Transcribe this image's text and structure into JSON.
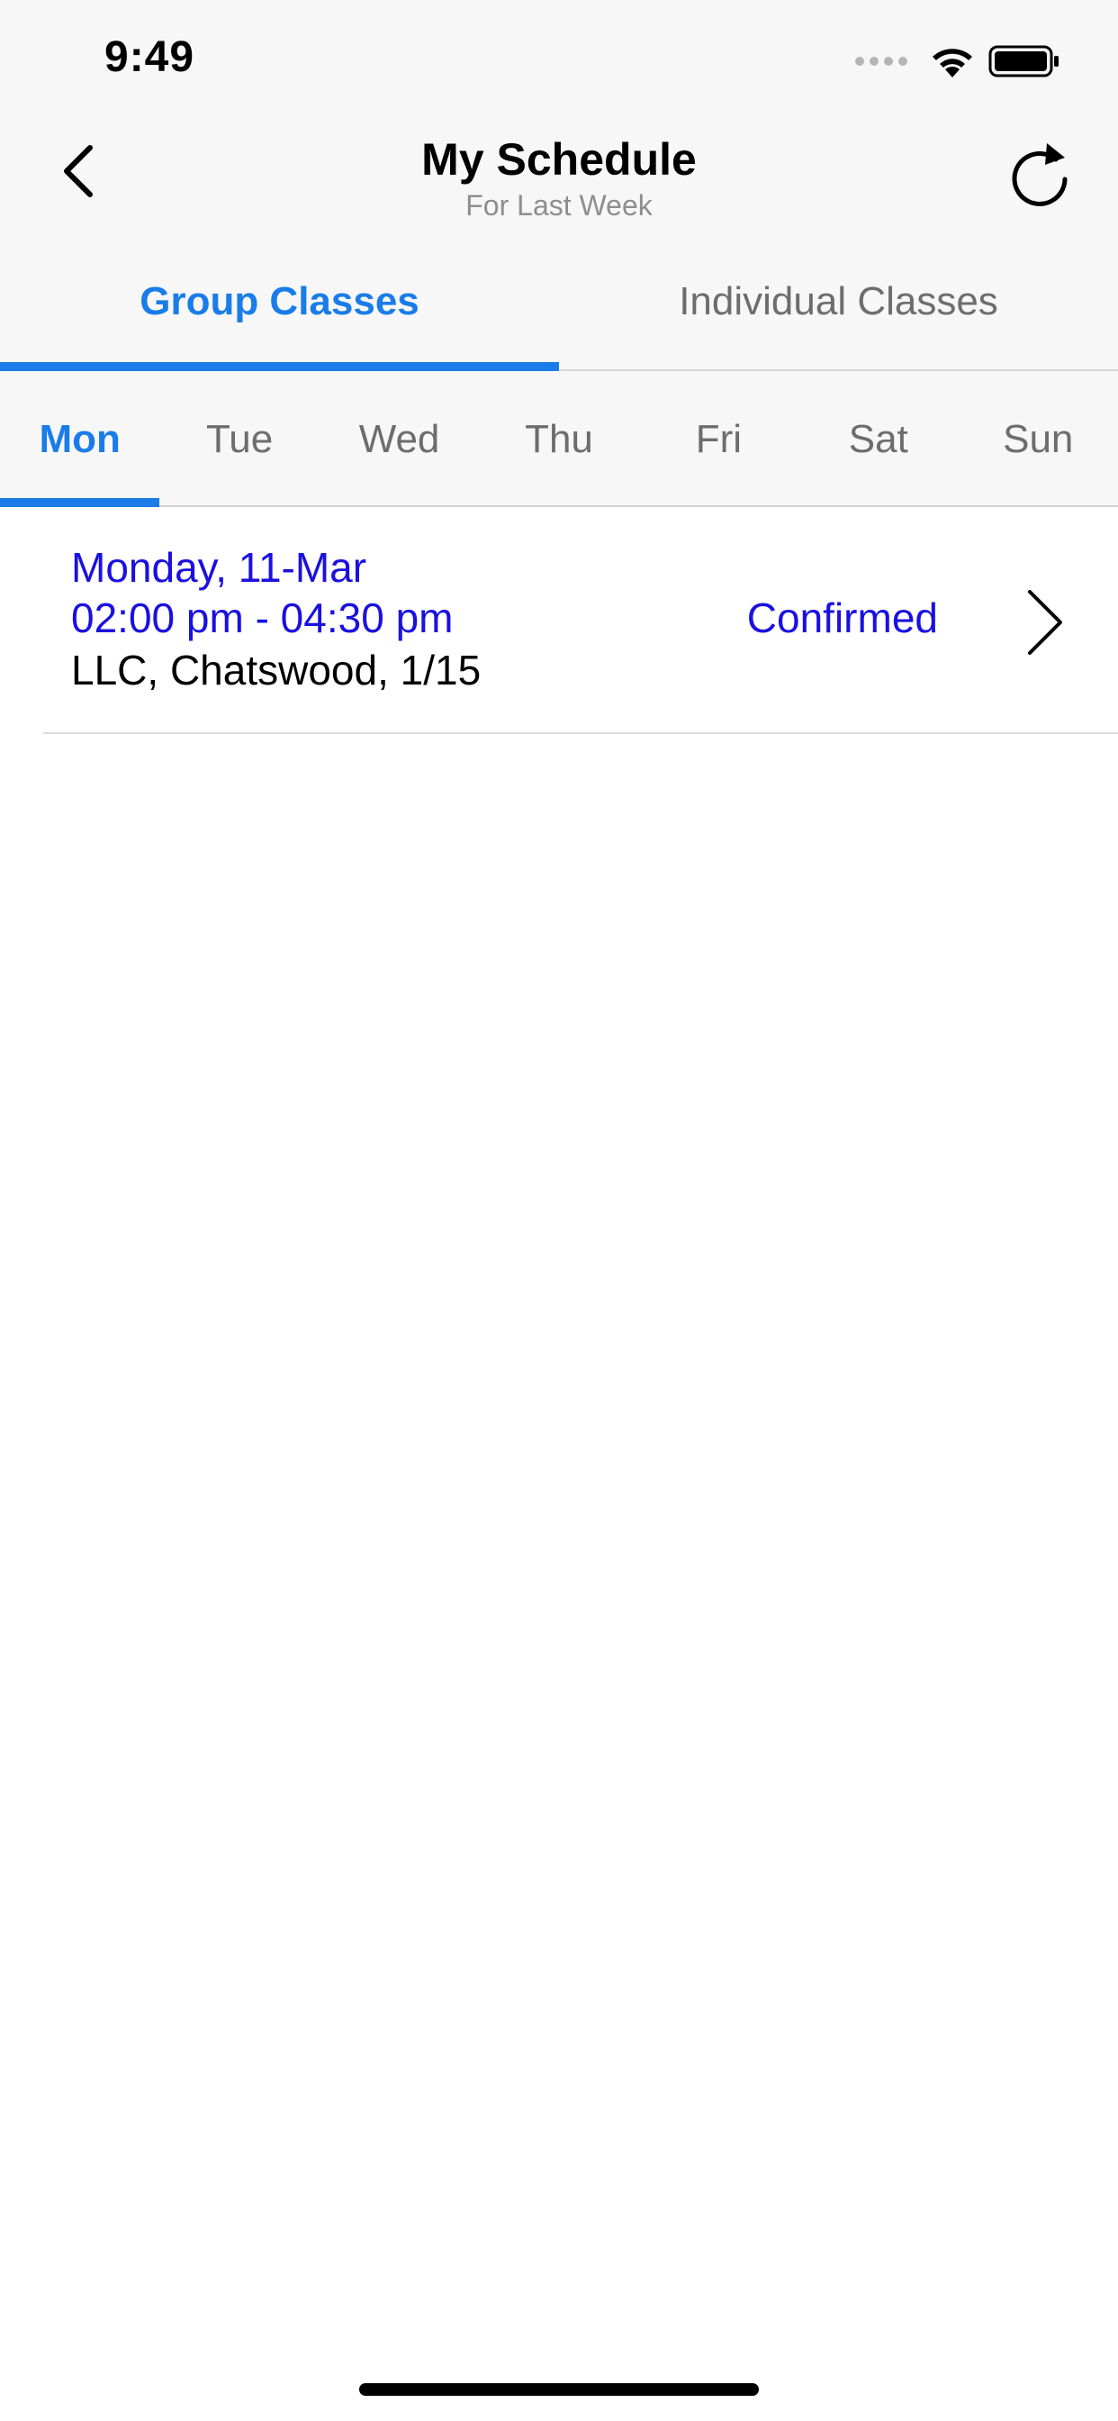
{
  "status_bar": {
    "time": "9:49",
    "icons": [
      "cellular-signal-icon",
      "wifi-icon",
      "battery-icon"
    ]
  },
  "nav": {
    "title": "My Schedule",
    "subtitle": "For Last Week",
    "back_icon": "chevron-left-icon",
    "refresh_icon": "refresh-icon"
  },
  "main_tabs": [
    {
      "label": "Group Classes",
      "active": true
    },
    {
      "label": "Individual Classes",
      "active": false
    }
  ],
  "day_tabs": [
    {
      "label": "Mon",
      "active": true
    },
    {
      "label": "Tue",
      "active": false
    },
    {
      "label": "Wed",
      "active": false
    },
    {
      "label": "Thu",
      "active": false
    },
    {
      "label": "Fri",
      "active": false
    },
    {
      "label": "Sat",
      "active": false
    },
    {
      "label": "Sun",
      "active": false
    }
  ],
  "classes": [
    {
      "date": "Monday, 11-Mar",
      "time": "02:00 pm - 04:30 pm",
      "location": "LLC, Chatswood, 1/15",
      "status": "Confirmed",
      "chevron_icon": "chevron-right-icon"
    }
  ],
  "colors": {
    "accent": "#1a7ce8",
    "link_text": "#1a10e0",
    "inactive_text": "#6d6d6d",
    "header_bg": "#f7f7f7"
  }
}
